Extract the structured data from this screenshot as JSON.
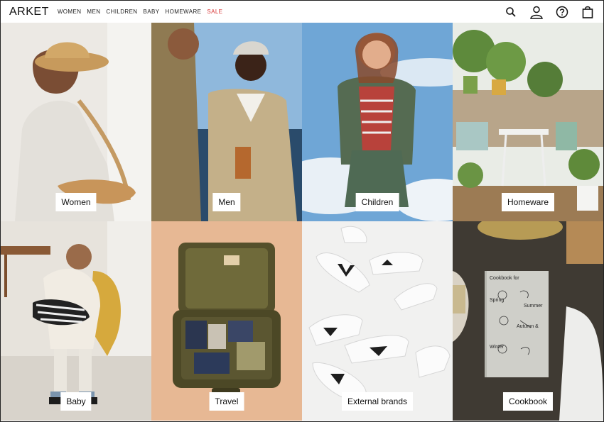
{
  "header": {
    "logo": "ARKET",
    "nav": [
      {
        "label": "WOMEN"
      },
      {
        "label": "MEN"
      },
      {
        "label": "CHILDREN"
      },
      {
        "label": "BABY"
      },
      {
        "label": "HOMEWARE"
      },
      {
        "label": "SALE",
        "color": "#d83434"
      }
    ],
    "icons": [
      "search-icon",
      "account-icon",
      "help-icon",
      "bag-icon"
    ]
  },
  "tiles": [
    {
      "label": "Women"
    },
    {
      "label": "Men"
    },
    {
      "label": "Children"
    },
    {
      "label": "Homeware"
    },
    {
      "label": "Baby"
    },
    {
      "label": "Travel"
    },
    {
      "label": "External brands"
    },
    {
      "label": "Cookbook"
    }
  ],
  "book": {
    "title": "Cookbook for",
    "seasons": [
      "Spring",
      "Summer",
      "Autumn &",
      "Winter"
    ]
  }
}
